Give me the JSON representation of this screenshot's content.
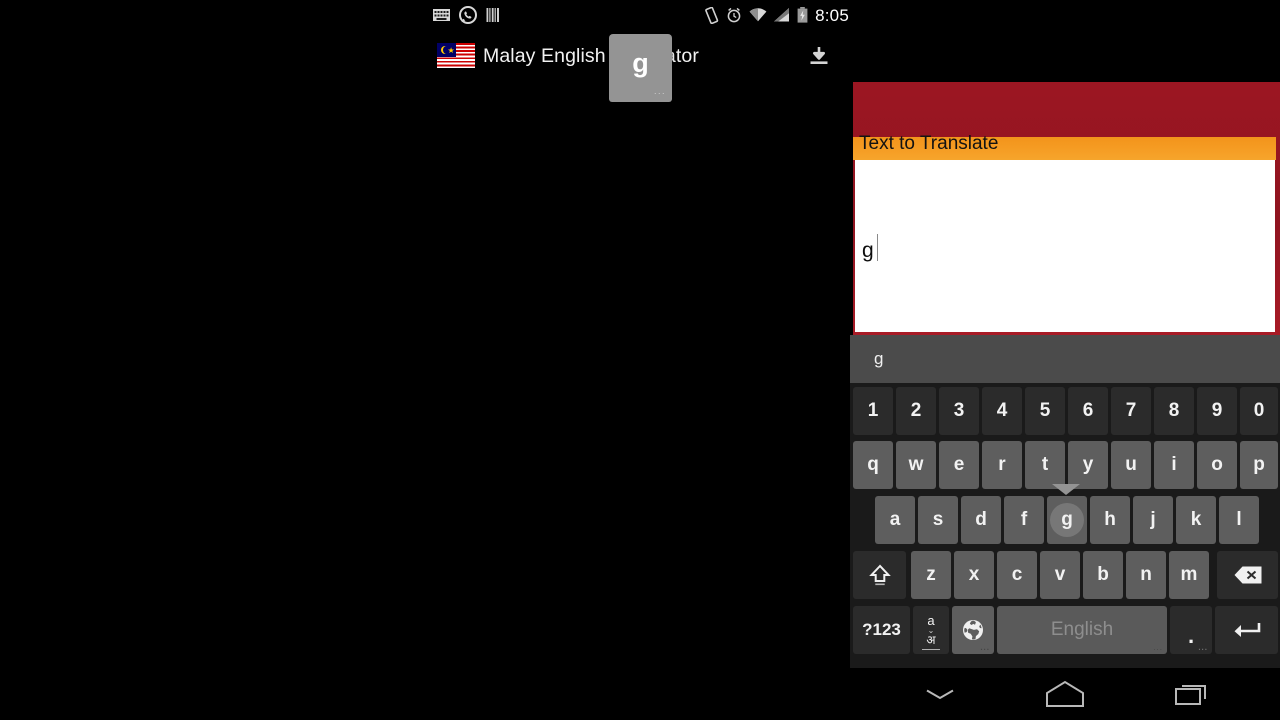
{
  "status_bar": {
    "time": "8:05",
    "left_icons": [
      "keyboard-icon",
      "whatsapp-icon",
      "barcode-icon"
    ],
    "right_icons": [
      "vibrate-icon",
      "alarm-icon",
      "wifi-icon",
      "signal-icon",
      "battery-charging-icon"
    ]
  },
  "app_bar": {
    "title": "Malay English Translator",
    "flag": "malaysia-flag",
    "action_icon": "download-icon"
  },
  "content": {
    "field_label": "Text to Translate",
    "input_value": "g",
    "colors": {
      "panel_red": "#8f1420",
      "label_orange": "#f59b22",
      "input_background": "#ffffff"
    }
  },
  "keyboard": {
    "suggestion": "g",
    "key_preview": {
      "char": "g",
      "more_indicator": "..."
    },
    "rows": {
      "numbers": [
        "1",
        "2",
        "3",
        "4",
        "5",
        "6",
        "7",
        "8",
        "9",
        "0"
      ],
      "top": [
        "q",
        "w",
        "e",
        "r",
        "t",
        "y",
        "u",
        "i",
        "o",
        "p"
      ],
      "home": [
        "a",
        "s",
        "d",
        "f",
        "g",
        "h",
        "j",
        "k",
        "l"
      ],
      "bottom": [
        "z",
        "x",
        "c",
        "v",
        "b",
        "n",
        "m"
      ]
    },
    "pressed_key": "g",
    "shift_key": "shift-icon",
    "backspace_key": "backspace-icon",
    "symbols_key": "?123",
    "language_key": {
      "latin": "a",
      "indic": "अ",
      "chevron": "⌄"
    },
    "globe_key": "globe-icon",
    "space_key": "English",
    "period_key": ".",
    "enter_key": "enter-icon"
  },
  "nav_bar": {
    "back": "hide-keyboard-icon",
    "home": "home-icon",
    "recents": "recents-icon"
  }
}
